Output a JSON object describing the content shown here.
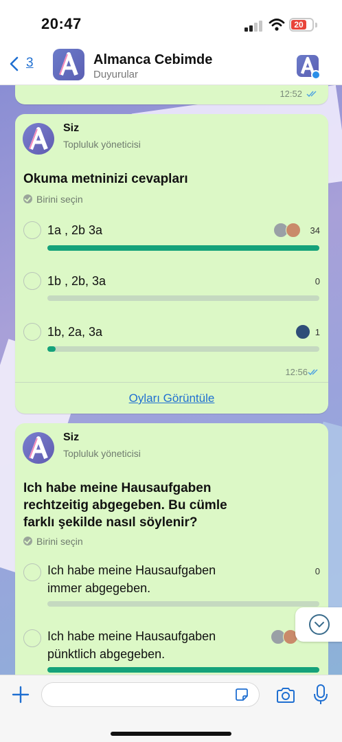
{
  "status_bar": {
    "time": "20:47",
    "battery": "20"
  },
  "header": {
    "back_count": "3",
    "title": "Almanca Cebimde",
    "subtitle": "Duyurular"
  },
  "previous_message": {
    "time": "12:52"
  },
  "poll1": {
    "sender": "Siz",
    "role": "Topluluk yöneticisi",
    "question": "Okuma metninizi cevapları",
    "hint": "Birini seçin",
    "options": [
      {
        "label": "1a , 2b 3a",
        "votes": "34",
        "share": 1.0
      },
      {
        "label": "1b , 2b, 3a",
        "votes": "0",
        "share": 0.0
      },
      {
        "label": "1b, 2a, 3a",
        "votes": "1",
        "share": 0.03
      }
    ],
    "time": "12:56",
    "view_votes": "Oyları Görüntüle"
  },
  "poll2": {
    "sender": "Siz",
    "role": "Topluluk yöneticisi",
    "question_lines": [
      "Ich habe meine Hausaufgaben",
      "rechtzeitig abgegeben. Bu cümle",
      "farklı şekilde nasıl söylenir?"
    ],
    "hint": "Birini seçin",
    "options": [
      {
        "label_lines": [
          "Ich habe meine Hausaufgaben",
          "immer abgegeben."
        ],
        "votes": "0",
        "share": 0.0
      },
      {
        "label_lines": [
          "Ich habe meine Hausaufgaben",
          "pünktlich abgegeben."
        ],
        "votes": "",
        "share": 1.0
      }
    ]
  },
  "input": {
    "placeholder": ""
  },
  "colors": {
    "bubble": "#dcf8c6",
    "bar": "#15a27a",
    "link": "#1f6fd1"
  },
  "icons": [
    "back-chevron-icon",
    "wifi-icon",
    "signal-icon",
    "battery-icon",
    "verified-icon",
    "check-icon",
    "double-tick-icon",
    "chevron-down-icon",
    "plus-icon",
    "sticker-icon",
    "camera-icon",
    "microphone-icon"
  ]
}
